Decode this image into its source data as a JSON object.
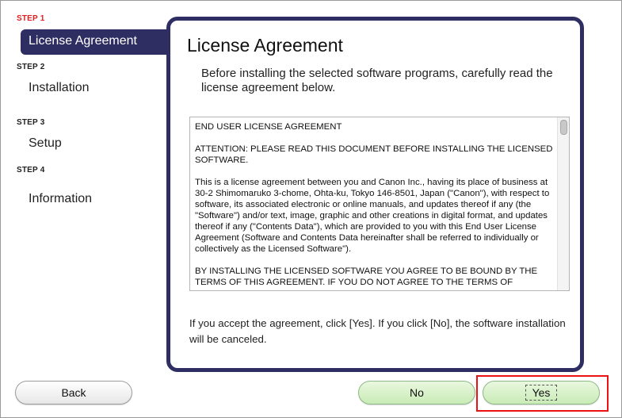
{
  "sidebar": {
    "steps": [
      {
        "step_label": "STEP 1",
        "name": "License Agreement"
      },
      {
        "step_label": "STEP 2",
        "name": "Installation"
      },
      {
        "step_label": "STEP 3",
        "name": "Setup"
      },
      {
        "step_label": "STEP 4",
        "name": "Information"
      }
    ]
  },
  "panel": {
    "title": "License Agreement",
    "intro": "Before installing the selected software programs, carefully read the license agreement below.",
    "license_text": "END USER LICENSE AGREEMENT\n\nATTENTION: PLEASE READ THIS DOCUMENT BEFORE INSTALLING THE LICENSED SOFTWARE.\n\nThis is a license agreement between you and Canon Inc., having its place of business at 30-2 Shimomaruko 3-chome, Ohta-ku, Tokyo 146-8501, Japan (\"Canon\"), with respect to software, its associated electronic or online manuals, and updates thereof if any (the \"Software\") and/or text, image, graphic and other creations in digital format, and updates thereof if any (\"Contents Data\"), which are provided to you with this End User License Agreement (Software and Contents Data hereinafter shall be referred to individually or collectively as the Licensed Software\").\n\nBY INSTALLING THE LICENSED SOFTWARE YOU AGREE TO BE BOUND BY THE TERMS OF THIS AGREEMENT. IF YOU DO NOT AGREE TO THE TERMS OF",
    "footer": "If you accept the agreement, click [Yes]. If you click [No], the software installation will be canceled."
  },
  "buttons": {
    "back": "Back",
    "no": "No",
    "yes": "Yes"
  },
  "colors": {
    "active_step": "#e02020",
    "panel_border": "#2f2e63",
    "highlight": "#ee1111"
  }
}
